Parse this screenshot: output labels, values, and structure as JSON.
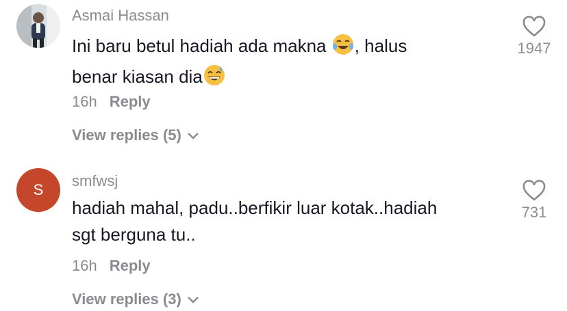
{
  "comments": [
    {
      "username": "Asmai Hassan",
      "text_line1": "Ini baru betul hadiah ada makna ",
      "text_line1_after": ", halus",
      "text_line2": "benar kiasan dia",
      "time": "16h",
      "reply_label": "Reply",
      "view_replies": "View replies (5)",
      "likes": "1947",
      "emoji1": "face-with-tears-of-joy-icon",
      "emoji2": "grinning-sweat-face-icon"
    },
    {
      "username": "smfwsj",
      "avatar_letter": "S",
      "text_line1": "hadiah mahal, padu..berfikir luar kotak..hadiah",
      "text_line2": "sgt berguna tu..",
      "time": "16h",
      "reply_label": "Reply",
      "view_replies": "View replies (3)",
      "likes": "731"
    }
  ],
  "colors": {
    "text": "#161823",
    "muted": "#8a8b91",
    "avatar_bg": "#c4472b"
  }
}
